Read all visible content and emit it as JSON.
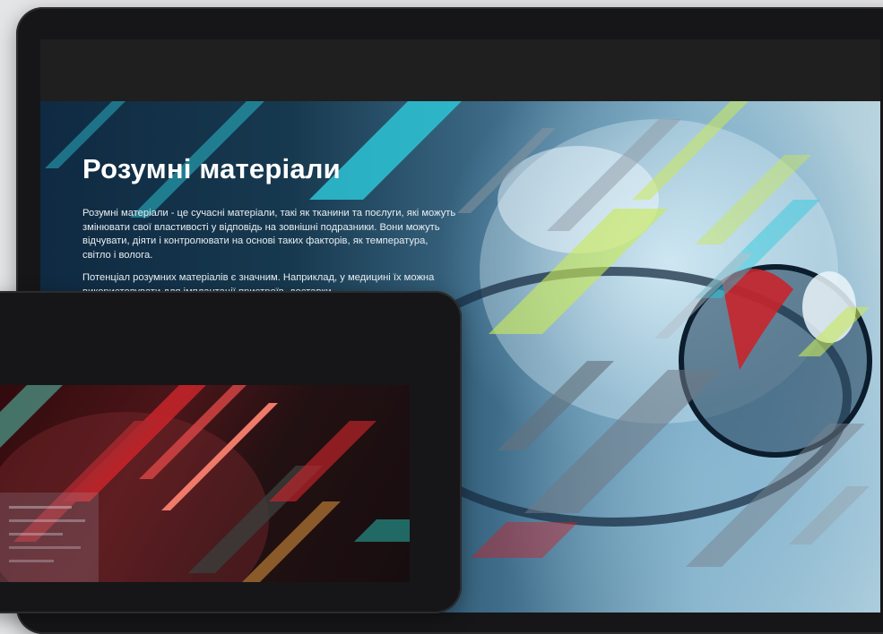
{
  "hero": {
    "title": "Розумні матеріали",
    "paragraph_1": "Розумні матеріали - це сучасні матеріали, такі як тканини та поєлуги, які можуть змінювати свої властивості у відповідь на зовнішні подразники. Вони можуть відчувати, діяти і контролювати на основі таких факторів, як температура, світло і волога.",
    "paragraph_2": "Потенціал розумних матеріалів є значним. Наприклад, у медицині їх можна використовувати для імплантації пристроїв, доставки"
  },
  "colors": {
    "accent_cyan": "#2ec4d6",
    "accent_lime": "#c9e85a",
    "accent_red": "#c8252b",
    "device_frame": "#161618"
  }
}
